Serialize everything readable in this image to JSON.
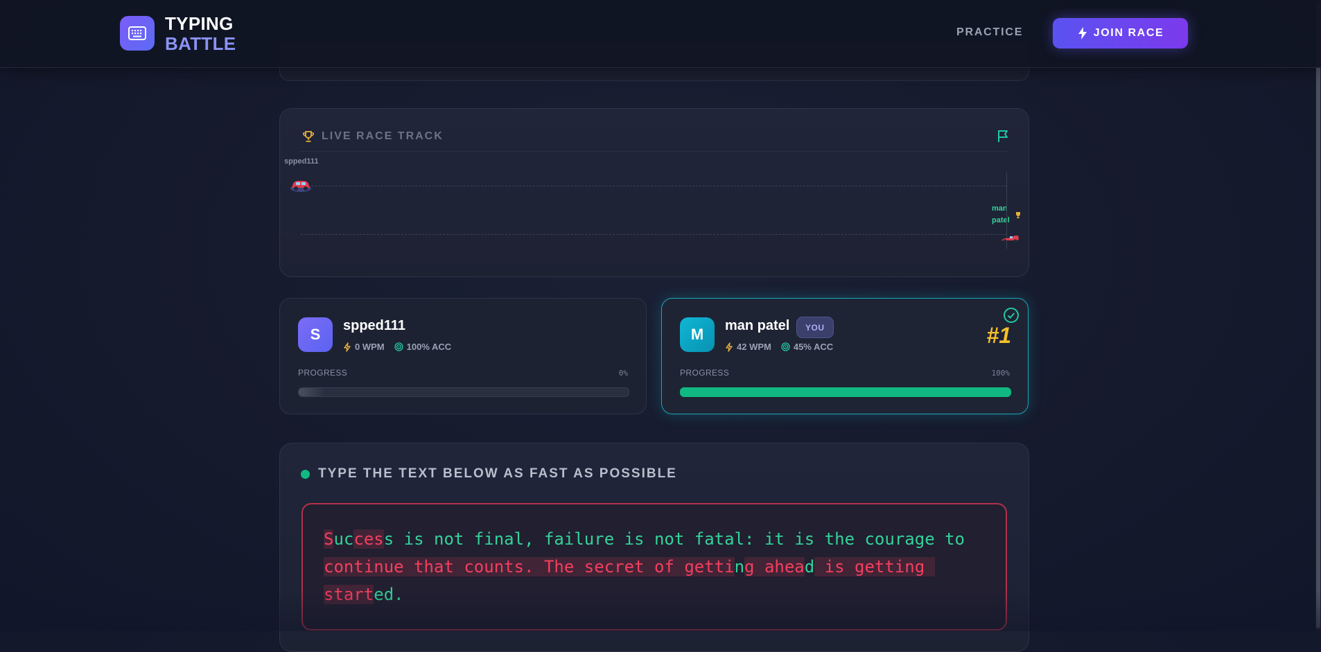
{
  "header": {
    "logo_line1": "TYPING",
    "logo_line2": "BATTLE",
    "logo_icon": "keyboard-icon",
    "nav_practice": "PRACTICE",
    "join_race": "JOIN RACE",
    "join_icon": "lightning-icon"
  },
  "track": {
    "title": "LIVE RACE TRACK",
    "title_icon": "trophy-icon",
    "flag_icon": "flag-icon",
    "racers": [
      {
        "name": "spped111",
        "progress": 0,
        "car": "car-icon"
      },
      {
        "name_line1": "man",
        "name_line2": "patel",
        "progress": 1.0,
        "car": "race-car-icon",
        "trophy": "trophy-icon"
      }
    ]
  },
  "players": [
    {
      "initial": "S",
      "name": "spped111",
      "wpm": "0 WPM",
      "acc": "100% ACC",
      "progress_label": "PROGRESS",
      "progress_pct": "0%",
      "progress": 0,
      "avatar_color": "#6366f1"
    },
    {
      "initial": "M",
      "name": "man patel",
      "badge": "YOU",
      "wpm": "42 WPM",
      "acc": "45% ACC",
      "progress_label": "PROGRESS",
      "progress_pct": "100%",
      "progress": 1.0,
      "rank": "#1",
      "avatar_color": "#06b6d4"
    }
  ],
  "typing": {
    "title": "TYPE THE TEXT BELOW AS FAST AS POSSIBLE",
    "passage": "Success is not final, failure is not fatal: it is the courage to continue that counts. The secret of getting ahead is getting started."
  },
  "colors": {
    "accent": "#5a52f0",
    "correct": "#34d399",
    "incorrect": "#f43f5e",
    "rank": "#f5c02a",
    "progress_fill": "#10b981"
  }
}
